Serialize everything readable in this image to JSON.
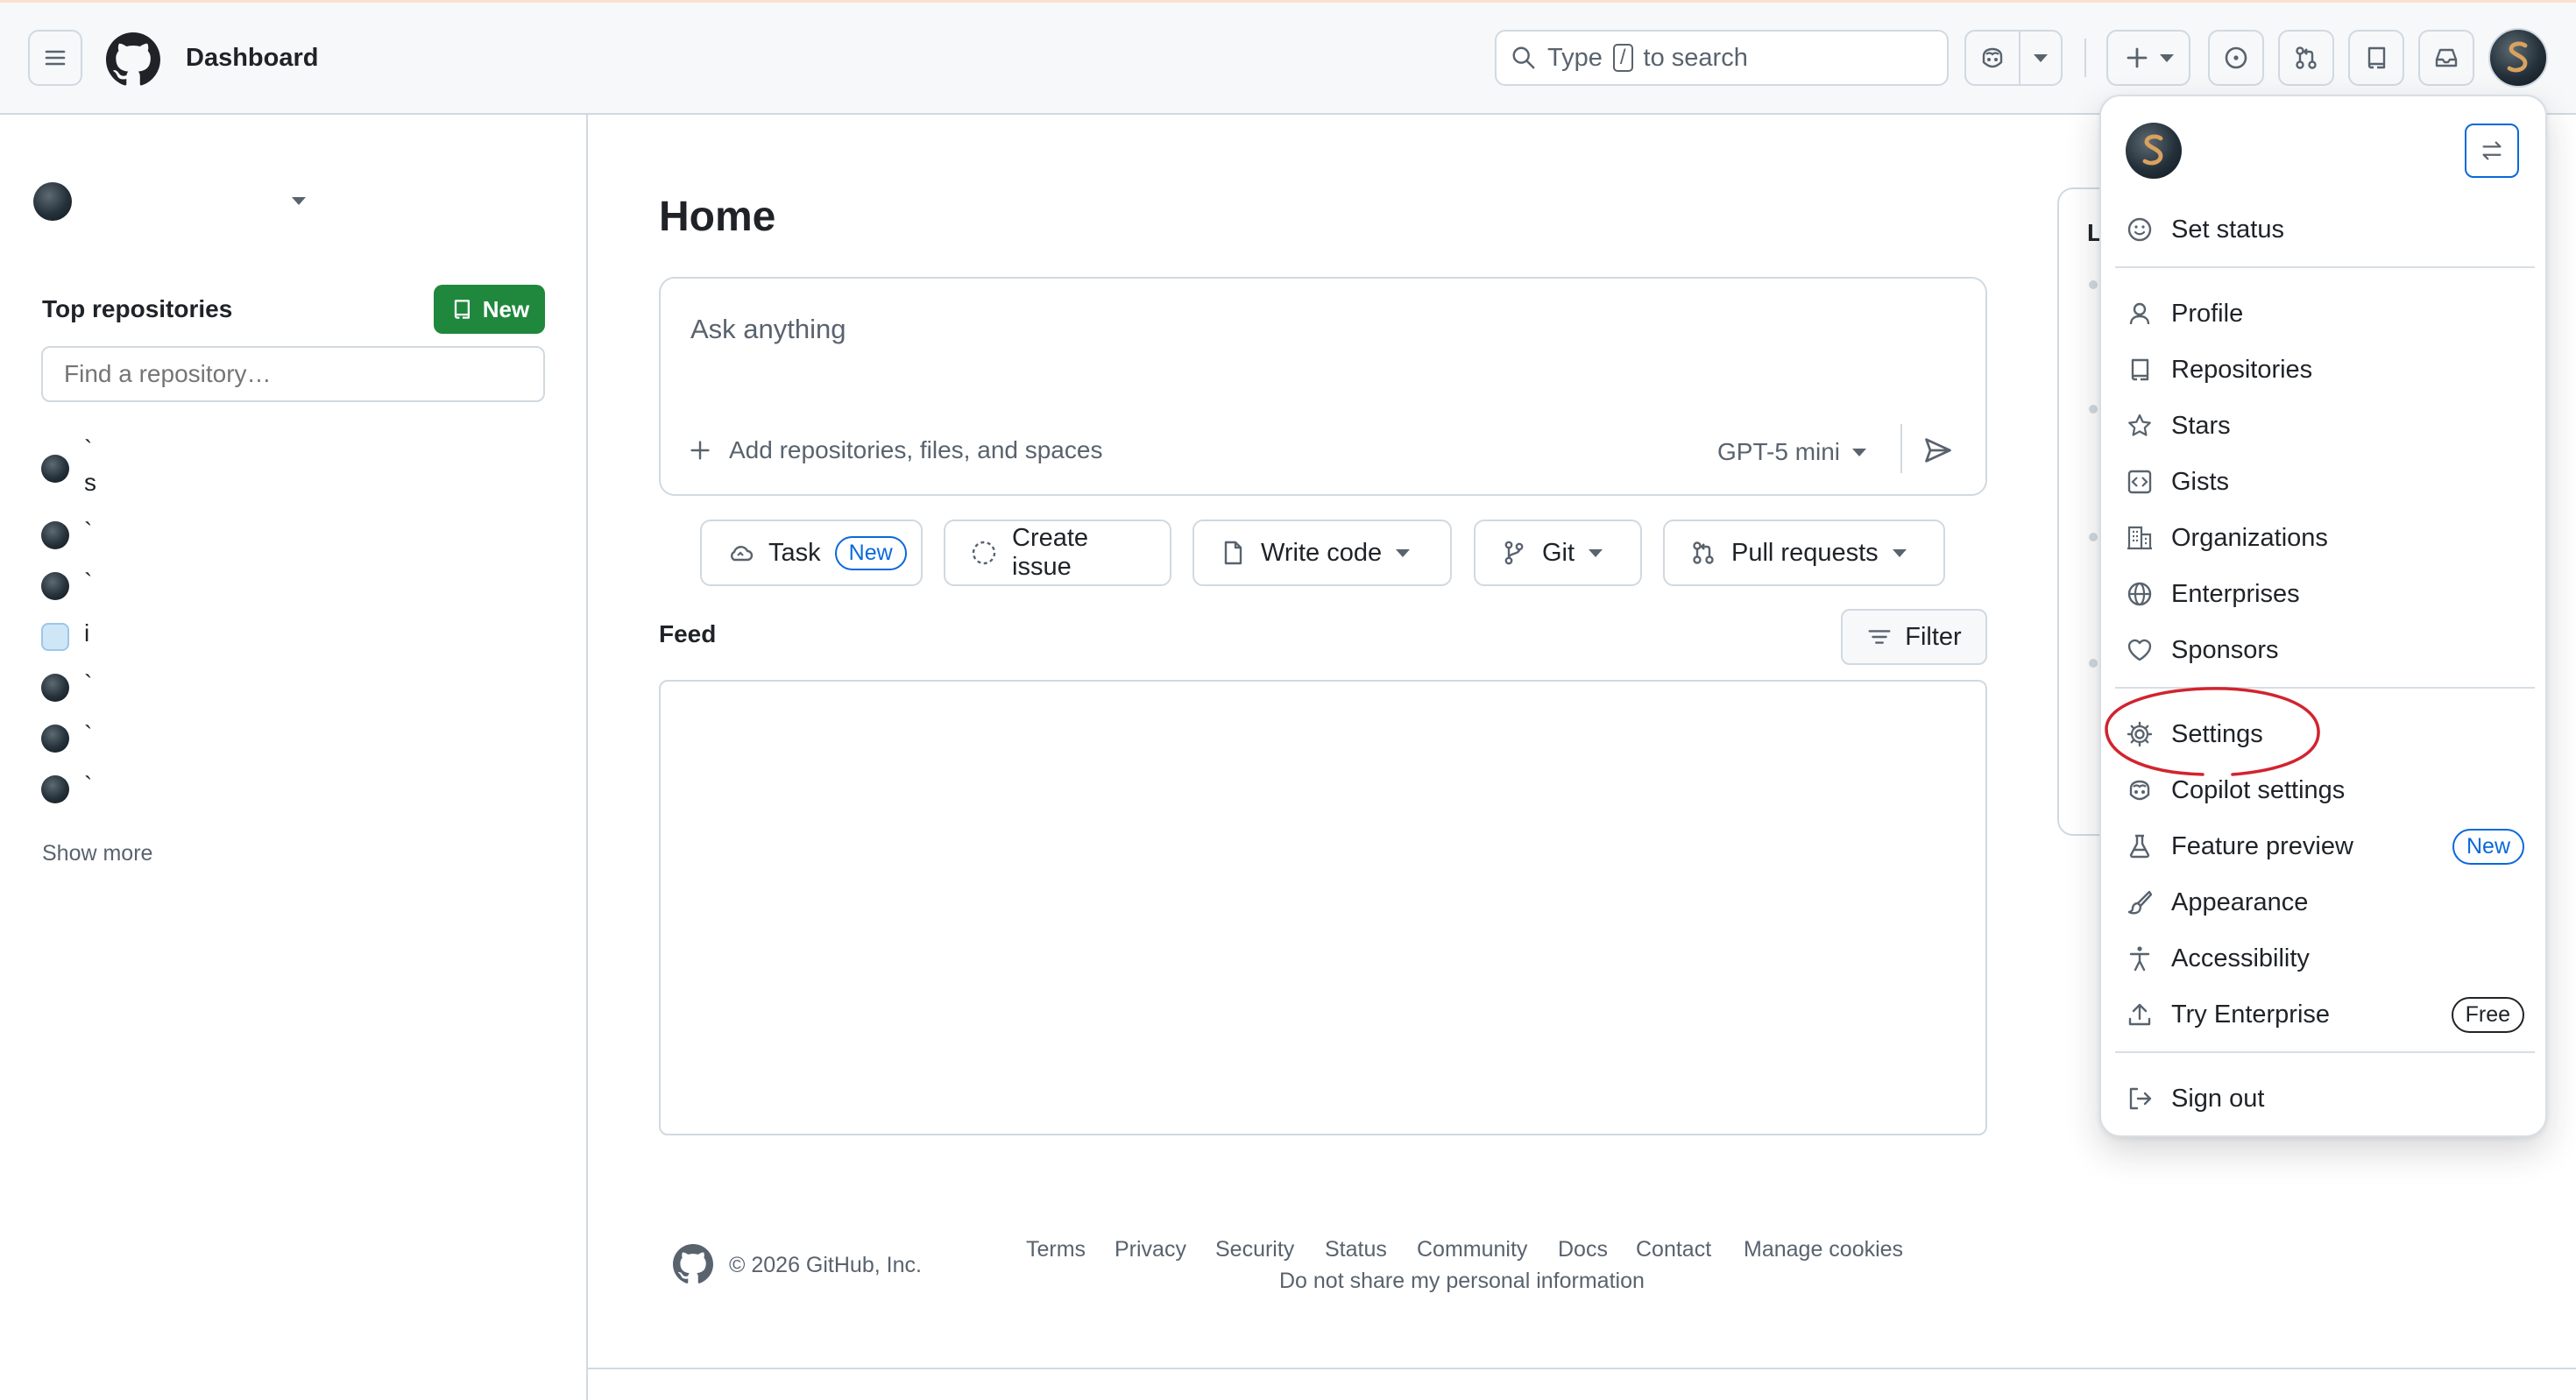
{
  "header": {
    "title": "Dashboard",
    "search": {
      "prefix": "Type",
      "key": "/",
      "suffix": "to search"
    }
  },
  "sidebar": {
    "top_repos_label": "Top repositories",
    "new_button": "New",
    "find_placeholder": "Find a repository…",
    "repos": [
      {
        "line1": "`",
        "line2": "s"
      },
      {
        "line1": "`"
      },
      {
        "line1": "`"
      },
      {
        "line1": "i"
      },
      {
        "line1": "`"
      },
      {
        "line1": "`"
      },
      {
        "line1": "`"
      }
    ],
    "show_more": "Show more"
  },
  "main": {
    "home_title": "Home",
    "ask": {
      "placeholder": "Ask anything",
      "add_label": "Add repositories, files, and spaces",
      "model": "GPT-5 mini"
    },
    "actions": {
      "task": "Task",
      "task_badge": "New",
      "create_issue": "Create issue",
      "write_code": "Write code",
      "git": "Git",
      "pull_requests": "Pull requests"
    },
    "feed_title": "Feed",
    "filter_button": "Filter",
    "right_panel_letter": "L"
  },
  "footer": {
    "copyright": "© 2026 GitHub, Inc.",
    "links": [
      "Terms",
      "Privacy",
      "Security",
      "Status",
      "Community",
      "Docs",
      "Contact",
      "Manage cookies"
    ],
    "privacy_line": "Do not share my personal information"
  },
  "menu": {
    "set_status": "Set status",
    "items_group1": [
      "Profile",
      "Repositories",
      "Stars",
      "Gists",
      "Organizations",
      "Enterprises",
      "Sponsors"
    ],
    "settings": "Settings",
    "copilot_settings": "Copilot settings",
    "feature_preview": "Feature preview",
    "feature_preview_badge": "New",
    "appearance": "Appearance",
    "accessibility": "Accessibility",
    "try_enterprise": "Try Enterprise",
    "try_enterprise_badge": "Free",
    "sign_out": "Sign out"
  },
  "colors": {
    "accent": "#0969da",
    "new_button": "#1f883d",
    "annotation": "#d1242f"
  }
}
